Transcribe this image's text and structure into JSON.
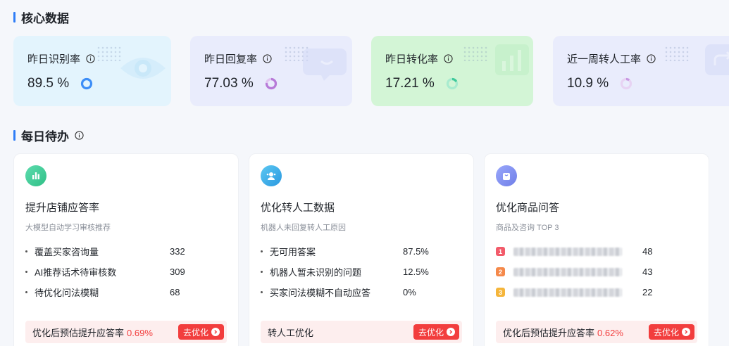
{
  "core_section": {
    "title": "核心数据"
  },
  "kpis": [
    {
      "label": "昨日识别率",
      "value": "89.5 %",
      "ring_color": "#3d8ef7",
      "bg": "#e3f4fd"
    },
    {
      "label": "昨日回复率",
      "value": "77.03 %",
      "ring_color": "#b77ad8",
      "bg": "#e9ecfc"
    },
    {
      "label": "昨日转化率",
      "value": "17.21 %",
      "ring_color": "#3fc99a",
      "bg": "#d3f5d6"
    },
    {
      "label": "近一周转人工率",
      "value": "10.9 %",
      "ring_color": "#c798e2",
      "bg": "#e9ecfc"
    }
  ],
  "todo_section": {
    "title": "每日待办"
  },
  "todos": [
    {
      "title": "提升店铺应答率",
      "subtitle": "大模型自动学习审核推荐",
      "icon": "bar-chart-icon",
      "icon_color": "#3cc88f",
      "items": [
        {
          "label": "覆盖买家咨询量",
          "value": "332"
        },
        {
          "label": "AI推荐话术待审核数",
          "value": "309"
        },
        {
          "label": "待优化问法模糊",
          "value": "68"
        }
      ],
      "footer_text": "优化后预估提升应答率",
      "footer_pct": "0.69%",
      "button": "去优化"
    },
    {
      "title": "优化转人工数据",
      "subtitle": "机器人未回复转人工原因",
      "icon": "agent-icon",
      "icon_color": "#2fa8e8",
      "items": [
        {
          "label": "无可用答案",
          "value": "87.5%"
        },
        {
          "label": "机器人暂未识别的问题",
          "value": "12.5%"
        },
        {
          "label": "买家问法模糊不自动应答",
          "value": "0%"
        }
      ],
      "footer_text": "转人工优化",
      "footer_pct": "",
      "button": "去优化"
    },
    {
      "title": "优化商品问答",
      "subtitle": "商品及咨询 TOP 3",
      "icon": "shopping-bag-icon",
      "icon_color": "#7d8cf0",
      "items": [
        {
          "rank": "1",
          "rank_color": "#f25b6a",
          "value": "48"
        },
        {
          "rank": "2",
          "rank_color": "#f5894a",
          "value": "43"
        },
        {
          "rank": "3",
          "rank_color": "#f5b53a",
          "value": "22"
        }
      ],
      "footer_text": "优化后预估提升应答率",
      "footer_pct": "0.62%",
      "button": "去优化"
    }
  ]
}
